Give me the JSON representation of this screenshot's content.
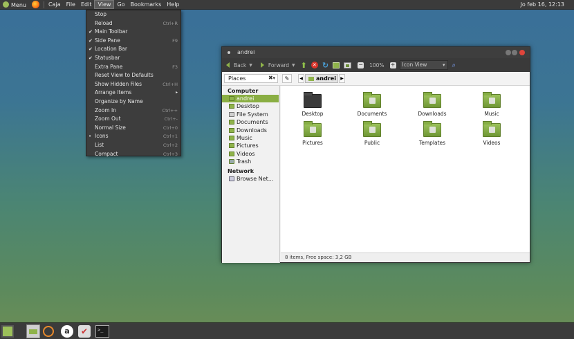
{
  "top_panel": {
    "menu_label": "Menu",
    "app_menus": [
      "Caja",
      "File",
      "Edit",
      "View",
      "Go",
      "Bookmarks",
      "Help"
    ],
    "active_menu": "View",
    "clock": "Jo feb 16, 12:13"
  },
  "view_menu": {
    "items": [
      {
        "label": "Stop",
        "shortcut": "",
        "mark": ""
      },
      {
        "label": "Reload",
        "shortcut": "Ctrl+R",
        "mark": ""
      },
      {
        "label": "Main Toolbar",
        "shortcut": "",
        "mark": "✔"
      },
      {
        "label": "Side Pane",
        "shortcut": "F9",
        "mark": "✔"
      },
      {
        "label": "Location Bar",
        "shortcut": "",
        "mark": "✔"
      },
      {
        "label": "Statusbar",
        "shortcut": "",
        "mark": "✔"
      },
      {
        "label": "Extra Pane",
        "shortcut": "F3",
        "mark": ""
      },
      {
        "label": "Reset View to Defaults",
        "shortcut": "",
        "mark": ""
      },
      {
        "label": "Show Hidden Files",
        "shortcut": "Ctrl+H",
        "mark": ""
      },
      {
        "label": "Arrange Items",
        "shortcut": "",
        "mark": "",
        "submenu": "▸"
      },
      {
        "label": "Organize by Name",
        "shortcut": "",
        "mark": ""
      },
      {
        "label": "Zoom In",
        "shortcut": "Ctrl++",
        "mark": ""
      },
      {
        "label": "Zoom Out",
        "shortcut": "Ctrl+-",
        "mark": ""
      },
      {
        "label": "Normal Size",
        "shortcut": "Ctrl+0",
        "mark": ""
      },
      {
        "label": "Icons",
        "shortcut": "Ctrl+1",
        "mark": "•"
      },
      {
        "label": "List",
        "shortcut": "Ctrl+2",
        "mark": ""
      },
      {
        "label": "Compact",
        "shortcut": "Ctrl+3",
        "mark": ""
      }
    ]
  },
  "window": {
    "title": "andrei",
    "toolbar": {
      "back": "Back",
      "forward": "Forward",
      "zoom": "100%",
      "view_mode": "Icon View"
    },
    "location": {
      "places_label": "Places",
      "crumb": "andrei"
    },
    "sidebar": {
      "computer_heading": "Computer",
      "computer_items": [
        "andrei",
        "Desktop",
        "File System",
        "Documents",
        "Downloads",
        "Music",
        "Pictures",
        "Videos",
        "Trash"
      ],
      "network_heading": "Network",
      "network_items": [
        "Browse Net..."
      ]
    },
    "files": [
      "Desktop",
      "Documents",
      "Downloads",
      "Music",
      "Pictures",
      "Public",
      "Templates",
      "Videos"
    ],
    "status": "8 items, Free space: 3,2 GB"
  }
}
